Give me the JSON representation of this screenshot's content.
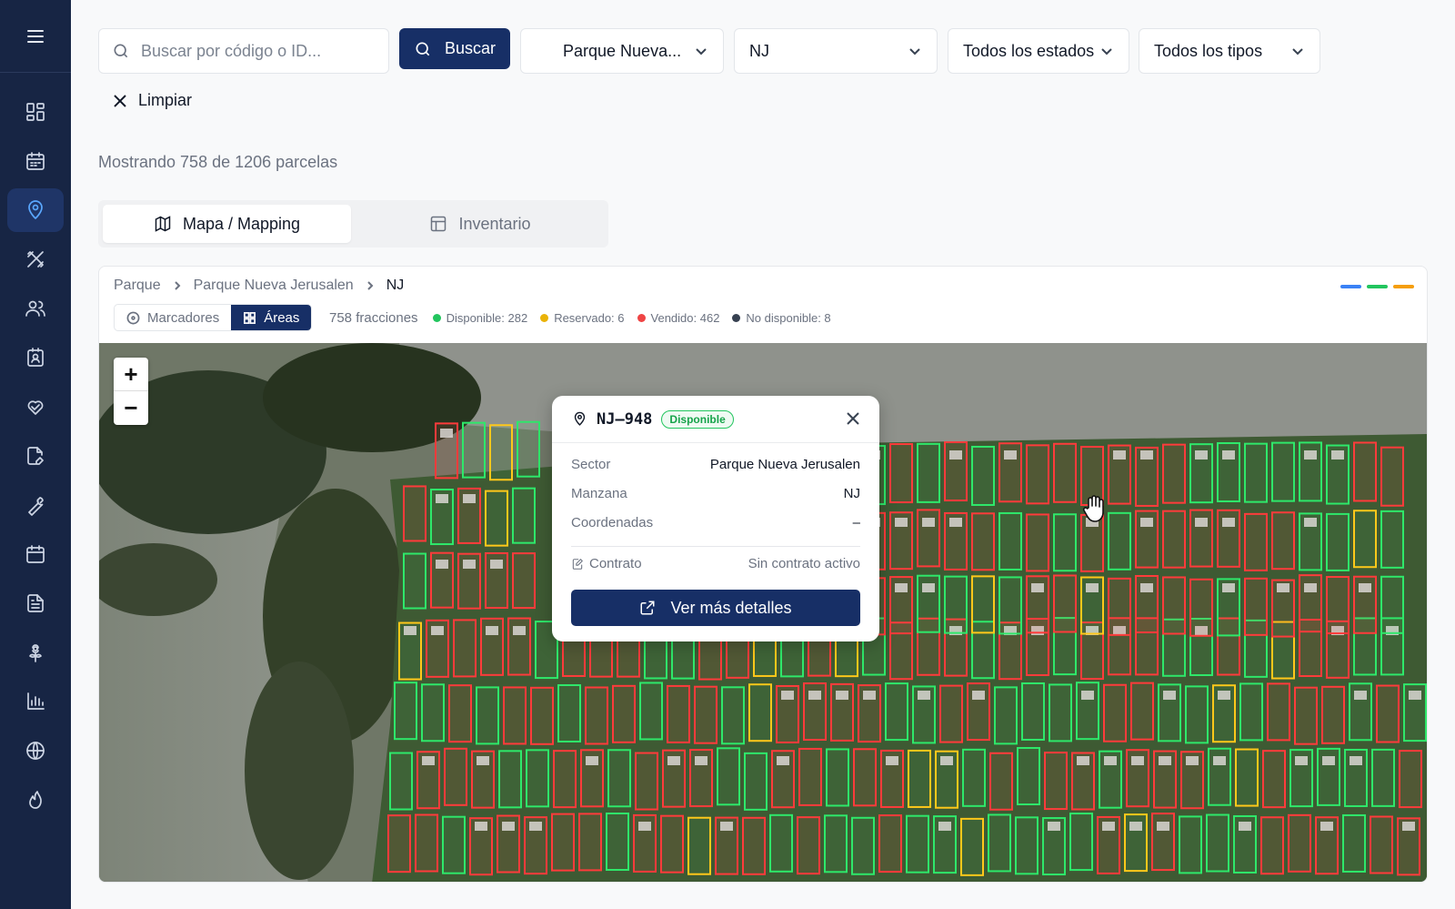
{
  "search": {
    "placeholder": "Buscar por código o ID...",
    "button_label": "Buscar"
  },
  "filters": {
    "park": "Parque Nueva...",
    "block": "NJ",
    "status": "Todos los estados",
    "type": "Todos los tipos"
  },
  "clear_label": "Limpiar",
  "showing_text": "Mostrando 758 de 1206 parcelas",
  "tabs": [
    {
      "label": "Mapa / Mapping",
      "active": true
    },
    {
      "label": "Inventario",
      "active": false
    }
  ],
  "breadcrumb": {
    "root": "Parque",
    "park": "Parque Nueva Jerusalen",
    "block": "NJ"
  },
  "legend_colors": [
    "#3b82f6",
    "#22c55e",
    "#f59e0b"
  ],
  "view_toggle": {
    "markers": "Marcadores",
    "areas": "Áreas"
  },
  "stats": {
    "count": "758 fracciones",
    "items": [
      {
        "label": "Disponible: 282",
        "color": "#22c55e"
      },
      {
        "label": "Reservado: 6",
        "color": "#eab308"
      },
      {
        "label": "Vendido: 462",
        "color": "#ef4444"
      },
      {
        "label": "No disponible: 8",
        "color": "#374151"
      }
    ]
  },
  "map": {
    "zoom_in": "+",
    "zoom_out": "−",
    "plot_colors": {
      "available": "#2ee86a",
      "sold": "#ff3b3b",
      "reserved": "#ffc81a"
    }
  },
  "popup": {
    "code": "NJ–948",
    "status": "Disponible",
    "rows": [
      {
        "label": "Sector",
        "value": "Parque Nueva Jerusalen"
      },
      {
        "label": "Manzana",
        "value": "NJ"
      },
      {
        "label": "Coordenadas",
        "value": "–"
      }
    ],
    "contract_label": "Contrato",
    "contract_value": "Sin contrato activo",
    "details_button": "Ver más detalles"
  },
  "sidebar": {
    "icons": [
      "menu-icon",
      "dashboard-icon",
      "calendar-icon",
      "map-pin-icon",
      "tools-icon",
      "users-icon",
      "id-card-icon",
      "heart-hand-icon",
      "document-edit-icon",
      "wrench-icon",
      "calendar-icon",
      "file-text-icon",
      "flower-icon",
      "bar-chart-icon",
      "globe-icon",
      "flame-icon"
    ],
    "active_index": 3
  }
}
